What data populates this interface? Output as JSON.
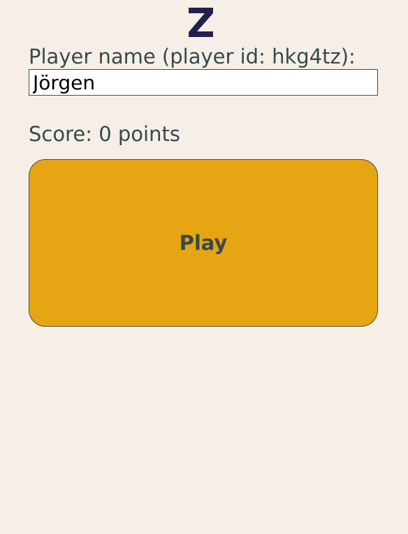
{
  "logo": {
    "icon": "z-logo-icon",
    "color": "#23204f"
  },
  "player": {
    "label": "Player name (player id: hkg4tz):",
    "name_value": "Jörgen"
  },
  "score": {
    "text": "Score: 0 points"
  },
  "play_button": {
    "label": "Play",
    "color": "#e6a613"
  },
  "colors": {
    "background": "#f6efe7",
    "text": "#38494c"
  }
}
